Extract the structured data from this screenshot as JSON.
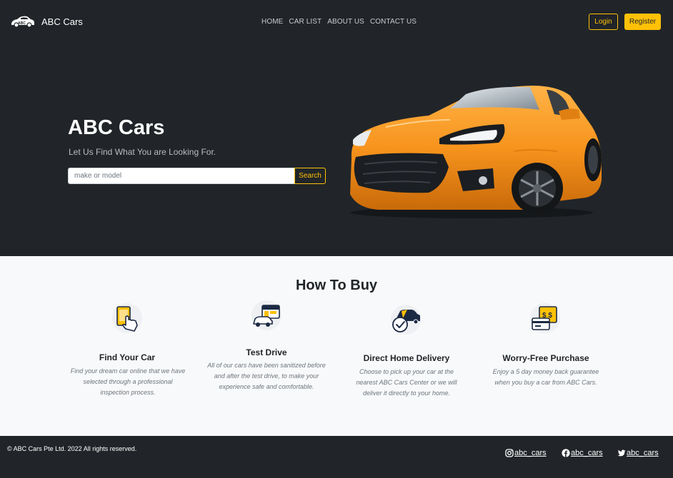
{
  "navbar": {
    "brand": "ABC Cars",
    "links": [
      "HOME",
      "CAR LIST",
      "ABOUT US",
      "CONTACT US"
    ],
    "login_label": "Login",
    "register_label": "Register"
  },
  "hero": {
    "title": "ABC Cars",
    "subtitle": "Let Us Find What You are Looking For.",
    "search_placeholder": "make or model",
    "search_value": "",
    "search_button": "Search"
  },
  "how_to_buy": {
    "title": "How To Buy",
    "steps": [
      {
        "icon": "phone-tap-icon",
        "title": "Find Your Car",
        "description": "Find your dream car online that we have selected through a professional inspection process."
      },
      {
        "icon": "car-showroom-icon",
        "title": "Test Drive",
        "description": "All of our cars have been sanitized before and after the test drive, to make your experience safe and comfortable."
      },
      {
        "icon": "car-delivery-icon",
        "title": "Direct Home Delivery",
        "description": "Choose to pick up your car at the nearest ABC Cars Center or we will deliver it directly to your home."
      },
      {
        "icon": "payment-card-icon",
        "title": "Worry-Free Purchase",
        "description": "Enjoy a 5 day money back guarantee when you buy a car from ABC Cars."
      }
    ]
  },
  "footer": {
    "copyright": "© ABC Cars Pte Ltd. 2022 All rights reserved.",
    "social": [
      {
        "icon": "instagram-icon",
        "label": "abc_cars"
      },
      {
        "icon": "facebook-icon",
        "label": "abc_cars"
      },
      {
        "icon": "twitter-icon",
        "label": "abc_cars"
      }
    ]
  },
  "colors": {
    "dark": "#212529",
    "accent": "#ffc107",
    "light_bg": "#f8f9fa",
    "car": "#f7941d"
  }
}
